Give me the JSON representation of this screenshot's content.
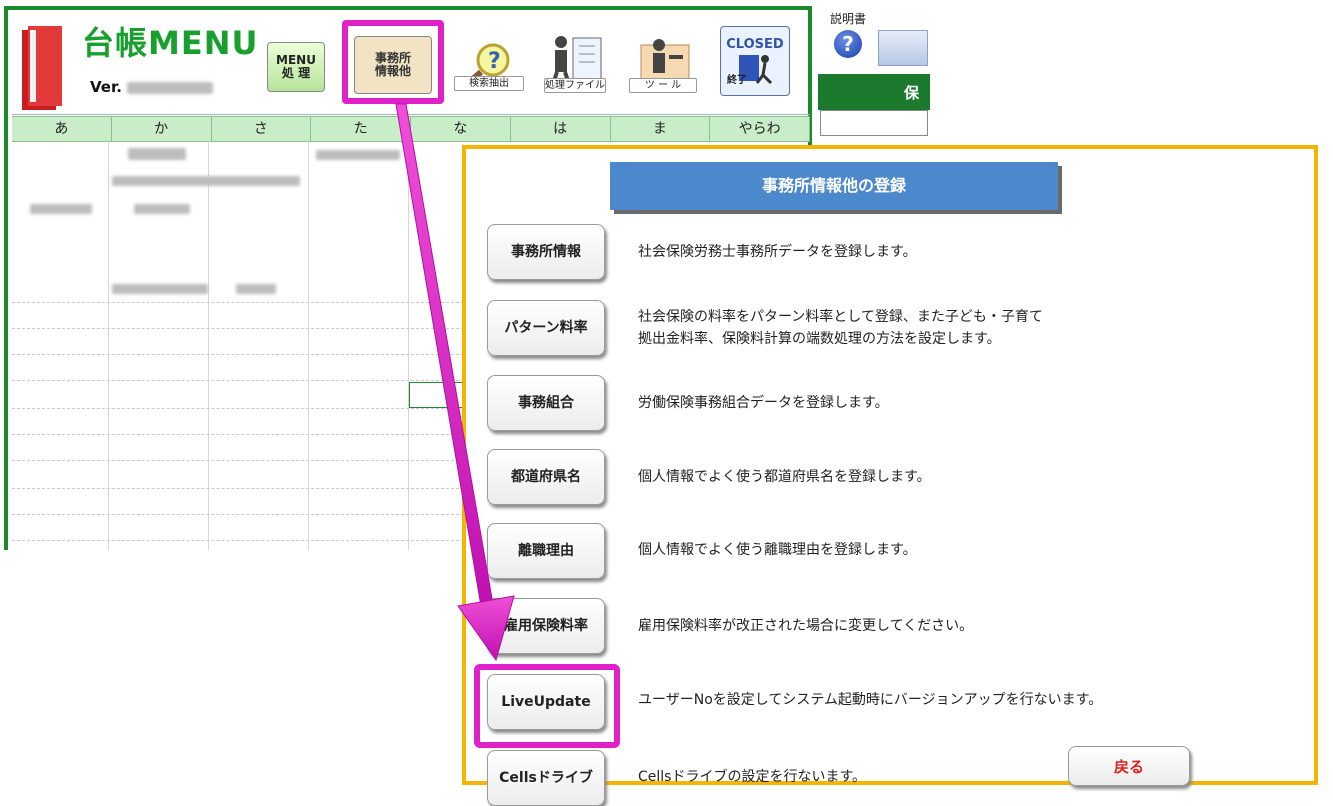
{
  "header": {
    "title_kanji": "台帳",
    "title_latin": "MENU",
    "version_label": "Ver."
  },
  "toolbar": {
    "menu_line1": "MENU",
    "menu_line2": "処 理",
    "office_line1": "事務所",
    "office_line2": "情報他",
    "search_label": "検索抽出",
    "process_file_label": "処理ファイル",
    "tool_label": "ツ ー ル",
    "closed_label": "CLOSED",
    "exit_label": "終了"
  },
  "kana_tabs": [
    "あ",
    "か",
    "さ",
    "た",
    "な",
    "は",
    "ま",
    "やらわ"
  ],
  "side": {
    "manual_label": "説明書",
    "green_label": "保"
  },
  "dialog": {
    "title": "事務所情報他の登録",
    "items": [
      {
        "button": "事務所情報",
        "desc": "社会保険労務士事務所データを登録します。"
      },
      {
        "button": "パターン料率",
        "desc": "社会保険の料率をパターン料率として登録、また子ども・子育て",
        "desc2": "拠出金料率、保険料計算の端数処理の方法を設定します。"
      },
      {
        "button": "事務組合",
        "desc": "労働保険事務組合データを登録します。"
      },
      {
        "button": "都道府県名",
        "desc": "個人情報でよく使う都道府県名を登録します。"
      },
      {
        "button": "離職理由",
        "desc": "個人情報でよく使う離職理由を登録します。"
      },
      {
        "button": "雇用保険料率",
        "desc": "雇用保険料率が改正された場合に変更してください。"
      },
      {
        "button": "LiveUpdate",
        "desc": "ユーザーNoを設定してシステム起動時にバージョンアップを行ないます。"
      },
      {
        "button": "Cellsドライブ",
        "desc": "Cellsドライブの設定を行ないます。"
      }
    ],
    "back_label": "戻る"
  },
  "colors": {
    "green_border": "#1a8a2a",
    "highlight": "#e020c8",
    "dialog_border": "#f4b400",
    "dialog_title_bg": "#4c88cc"
  }
}
